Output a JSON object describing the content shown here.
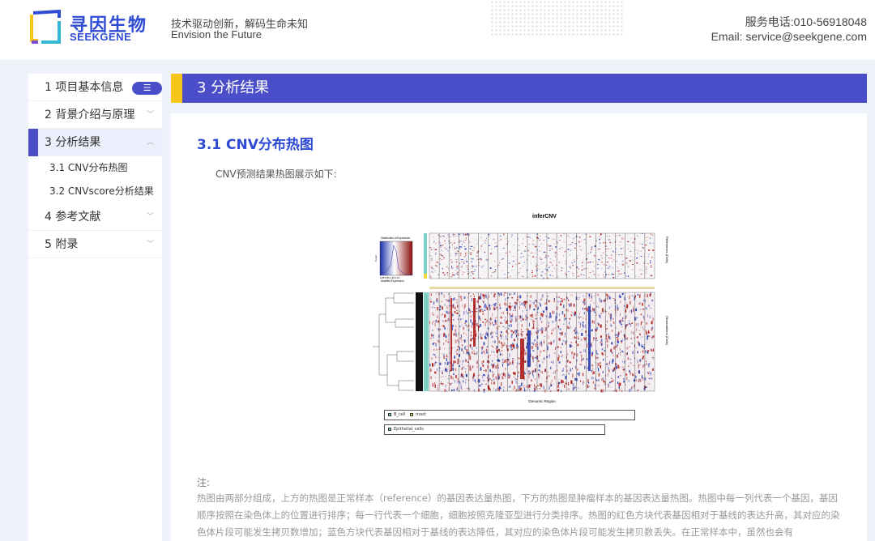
{
  "header": {
    "logo_cn": "寻因生物",
    "logo_en": "SEEKGENE",
    "slogan_cn": "技术驱动创新，解码生命未知",
    "slogan_en": "Envision the Future",
    "phone": "服务电话:010-56918048",
    "email": "Email: service@seekgene.com"
  },
  "sidebar": {
    "toc_icon": "list-indent-icon",
    "items": [
      {
        "label": "1 项目基本信息"
      },
      {
        "label": "2 背景介绍与原理"
      },
      {
        "label": "3 分析结果"
      },
      {
        "label": "3.1 CNV分布热图"
      },
      {
        "label": "3.2 CNVscore分析结果"
      },
      {
        "label": "4 参考文献"
      },
      {
        "label": "5 附录"
      }
    ]
  },
  "section": {
    "title": "3 分析结果"
  },
  "subsection": {
    "title": "3.1 CNV分布热图",
    "desc": "CNV预测结果热图展示如下:"
  },
  "figure": {
    "title": "inferCNV",
    "colorkey_title": "Distribution of Expression",
    "colorkey_ylabel": "Count",
    "colorkey_ticks": "0.85   0.95   1.05   1.15",
    "colorkey_xlabel": "Modified Expression",
    "right_label_top": "References (Cells)",
    "right_label_bottom": "Observations (Cells)",
    "x_label": "Genomic Region",
    "legend1": [
      "B_cell",
      "mast"
    ],
    "legend2": [
      "Epithelial_cells"
    ],
    "colors": {
      "amp": "#a8120f",
      "del": "#1a2fa8",
      "ref_bar": "#7fd0c4"
    }
  },
  "note": {
    "label": "注:",
    "text": "热图由两部分组成，上方的热图是正常样本（reference）的基因表达量热图，下方的热图是肿瘤样本的基因表达量热图。热图中每一列代表一个基因，基因顺序按照在染色体上的位置进行排序；每一行代表一个细胞，细胞按照克隆亚型进行分类排序。热图的红色方块代表基因相对于基线的表达升高，其对应的染色体片段可能发生拷贝数增加；蓝色方块代表基因相对于基线的表达降低，其对应的染色体片段可能发生拷贝数丢失。在正常样本中，虽然也会有"
  }
}
